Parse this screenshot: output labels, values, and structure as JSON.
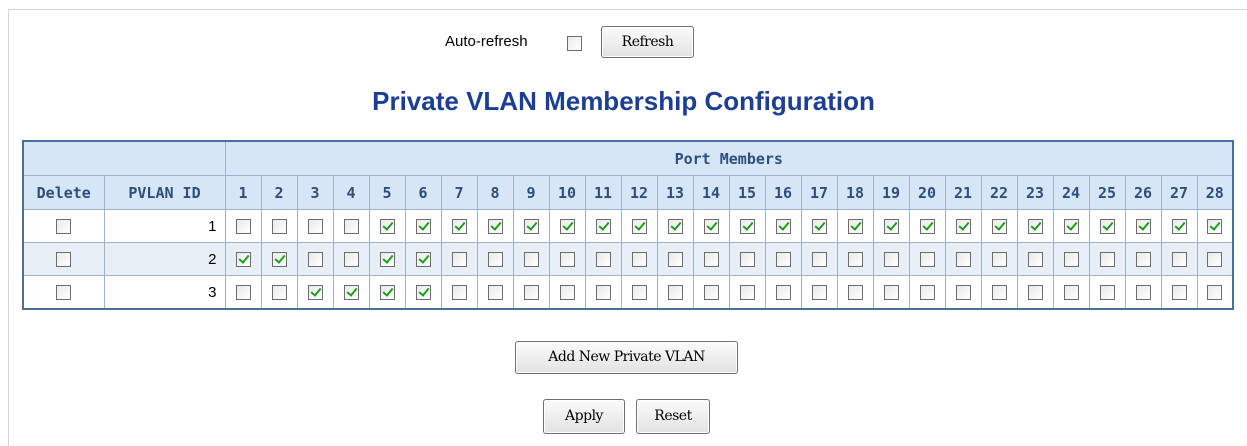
{
  "topbar": {
    "autorefresh_label": "Auto-refresh",
    "autorefresh_checked": false,
    "refresh_label": "Refresh"
  },
  "title": "Private VLAN Membership Configuration",
  "table": {
    "group_header": "Port Members",
    "delete_header": "Delete",
    "pvlan_id_header": "PVLAN ID",
    "ports": [
      "1",
      "2",
      "3",
      "4",
      "5",
      "6",
      "7",
      "8",
      "9",
      "10",
      "11",
      "12",
      "13",
      "14",
      "15",
      "16",
      "17",
      "18",
      "19",
      "20",
      "21",
      "22",
      "23",
      "24",
      "25",
      "26",
      "27",
      "28"
    ],
    "rows": [
      {
        "delete": false,
        "pvlan_id": "1",
        "members": [
          false,
          false,
          false,
          false,
          true,
          true,
          true,
          true,
          true,
          true,
          true,
          true,
          true,
          true,
          true,
          true,
          true,
          true,
          true,
          true,
          true,
          true,
          true,
          true,
          true,
          true,
          true,
          true
        ]
      },
      {
        "delete": false,
        "pvlan_id": "2",
        "members": [
          true,
          true,
          false,
          false,
          true,
          true,
          false,
          false,
          false,
          false,
          false,
          false,
          false,
          false,
          false,
          false,
          false,
          false,
          false,
          false,
          false,
          false,
          false,
          false,
          false,
          false,
          false,
          false
        ]
      },
      {
        "delete": false,
        "pvlan_id": "3",
        "members": [
          false,
          false,
          true,
          true,
          true,
          true,
          false,
          false,
          false,
          false,
          false,
          false,
          false,
          false,
          false,
          false,
          false,
          false,
          false,
          false,
          false,
          false,
          false,
          false,
          false,
          false,
          false,
          false
        ]
      }
    ]
  },
  "buttons": {
    "add_label": "Add New Private VLAN",
    "apply_label": "Apply",
    "reset_label": "Reset"
  },
  "colors": {
    "title": "#1c3f95",
    "header_bg": "#d7e6f6",
    "header_text": "#2d4f7c",
    "table_border": "#4a6f98",
    "check_mark": "#1e9e1e"
  }
}
